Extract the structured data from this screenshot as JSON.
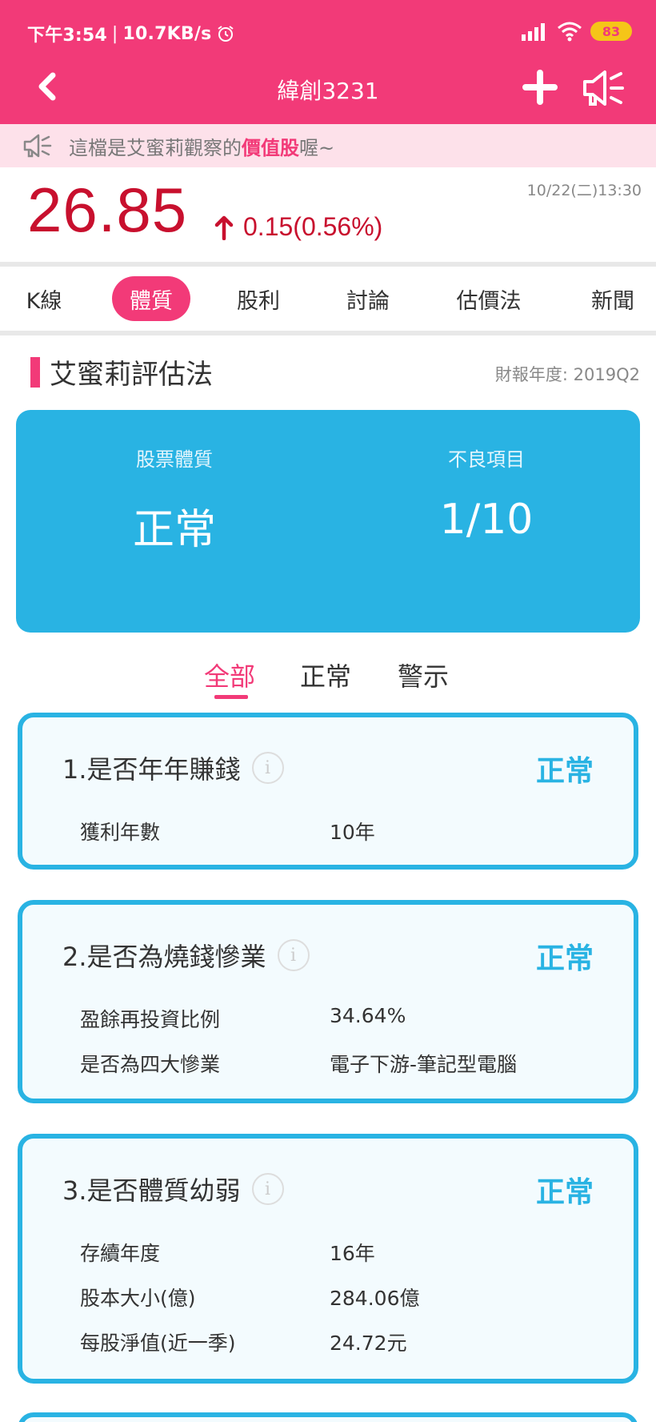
{
  "status_bar": {
    "time": "下午3:54",
    "speed": "10.7KB/s",
    "battery": "83",
    "icons": [
      "alarm-icon",
      "signal-icon",
      "wifi-icon",
      "battery-icon"
    ]
  },
  "nav": {
    "title": "緯創3231",
    "icons": [
      "back-chevron-icon",
      "plus-icon",
      "speaker-icon"
    ]
  },
  "notice": {
    "prefix": "這檔是艾蜜莉觀察的",
    "highlight": "價值股",
    "suffix": "喔~"
  },
  "quote": {
    "price": "26.85",
    "change": "0.15(0.56%)",
    "timestamp": "10/22(二)13:30"
  },
  "tabs": [
    {
      "label": "K線"
    },
    {
      "label": "體質"
    },
    {
      "label": "股利"
    },
    {
      "label": "討論"
    },
    {
      "label": "估價法"
    },
    {
      "label": "新聞"
    }
  ],
  "section": {
    "title": "艾蜜莉評估法",
    "year": "財報年度: 2019Q2"
  },
  "summary": {
    "health_label": "股票體質",
    "health_value": "正常",
    "bad_label": "不良項目",
    "bad_value": "1/10"
  },
  "filters": [
    {
      "label": "全部"
    },
    {
      "label": "正常"
    },
    {
      "label": "警示"
    }
  ],
  "cards": [
    {
      "title": "1.是否年年賺錢",
      "status": "正常",
      "rows": [
        {
          "label": "獲利年數",
          "value": "10年"
        }
      ]
    },
    {
      "title": "2.是否為燒錢慘業",
      "status": "正常",
      "rows": [
        {
          "label": "盈餘再投資比例",
          "value": "34.64%"
        },
        {
          "label": "是否為四大慘業",
          "value": "電子下游-筆記型電腦"
        }
      ]
    },
    {
      "title": "3.是否體質幼弱",
      "status": "正常",
      "rows": [
        {
          "label": "存續年度",
          "value": "16年"
        },
        {
          "label": "股本大小(億)",
          "value": "284.06億"
        },
        {
          "label": "每股淨值(近一季)",
          "value": "24.72元"
        }
      ]
    }
  ],
  "colors": {
    "brand": "#f23a78",
    "accent_blue": "#29b3e3",
    "price_red": "#c8102e"
  }
}
